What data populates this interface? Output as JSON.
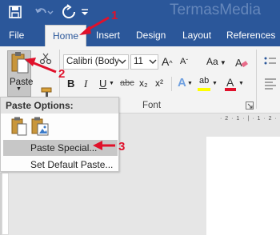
{
  "watermark": "TermasMedia",
  "tabs": [
    {
      "label": "File"
    },
    {
      "label": "Home",
      "active": true
    },
    {
      "label": "Insert"
    },
    {
      "label": "Design"
    },
    {
      "label": "Layout"
    },
    {
      "label": "References"
    }
  ],
  "clipboard": {
    "paste_label": "Paste"
  },
  "font": {
    "family": "Calibri (Body",
    "size": "11",
    "group_label": "Font",
    "aa_label": "Aa",
    "bold": "B",
    "italic": "I",
    "underline": "U",
    "strike": "abc",
    "subscript": "x₂",
    "superscript": "x²",
    "effects": "A",
    "highlight": "ab",
    "font_color": "A"
  },
  "paste_menu": {
    "header": "Paste Options:",
    "items": [
      {
        "label": "Paste Special..."
      },
      {
        "label": "Set Default Paste..."
      }
    ]
  },
  "annotations": [
    "1",
    "2",
    "3"
  ],
  "colors": {
    "accent": "#2b579a",
    "annotation": "#e0112b",
    "highlight": "#ffff00",
    "font_color": "#e0112b"
  }
}
